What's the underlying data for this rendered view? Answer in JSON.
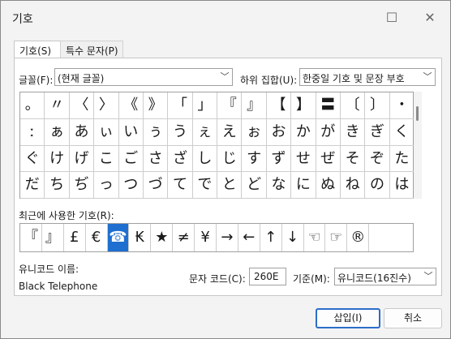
{
  "window": {
    "title": "기호"
  },
  "titlebar": {
    "maximize_glyph": "☐",
    "close_glyph": "✕"
  },
  "tabs": [
    {
      "label": "기호(S)"
    },
    {
      "label": "특수 문자(P)"
    }
  ],
  "font": {
    "label": "글꼴(F):",
    "value": "(현재 글꼴)"
  },
  "subset": {
    "label": "하위 집합(U):",
    "value": "한중일 기호 및 문장 부호"
  },
  "symbols": [
    "。",
    "〃",
    "〈",
    "〉",
    "《",
    "》",
    "「",
    "」",
    "『",
    "』",
    "【",
    "】",
    "〓",
    "〔",
    "〕",
    "・",
    "ː",
    "ぁ",
    "あ",
    "ぃ",
    "い",
    "ぅ",
    "う",
    "ぇ",
    "え",
    "ぉ",
    "お",
    "か",
    "が",
    "き",
    "ぎ",
    "く",
    "ぐ",
    "け",
    "げ",
    "こ",
    "ご",
    "さ",
    "ざ",
    "し",
    "じ",
    "す",
    "ず",
    "せ",
    "ぜ",
    "そ",
    "ぞ",
    "た",
    "だ",
    "ち",
    "ぢ",
    "っ",
    "つ",
    "づ",
    "て",
    "で",
    "と",
    "ど",
    "な",
    "に",
    "ぬ",
    "ね",
    "の",
    "は"
  ],
  "recent": {
    "label": "최근에 사용한 기호(R):",
    "items": [
      "『",
      "』",
      "£",
      "€",
      "☎",
      "₭",
      "★",
      "≠",
      "¥",
      "→",
      "←",
      "↑",
      "↓",
      "☜",
      "☞",
      "®"
    ],
    "selected_index": 4
  },
  "unicode_name": {
    "label": "유니코드 이름:",
    "value": "Black Telephone"
  },
  "char_code": {
    "label": "문자 코드(C):",
    "value": "260E"
  },
  "basis": {
    "label": "기준(M):",
    "value": "유니코드(16진수)"
  },
  "buttons": {
    "insert": "삽입(I)",
    "cancel": "취소"
  },
  "icons": {
    "dropdown": "chevron-down-icon",
    "maximize": "maximize-icon",
    "close": "close-icon"
  }
}
